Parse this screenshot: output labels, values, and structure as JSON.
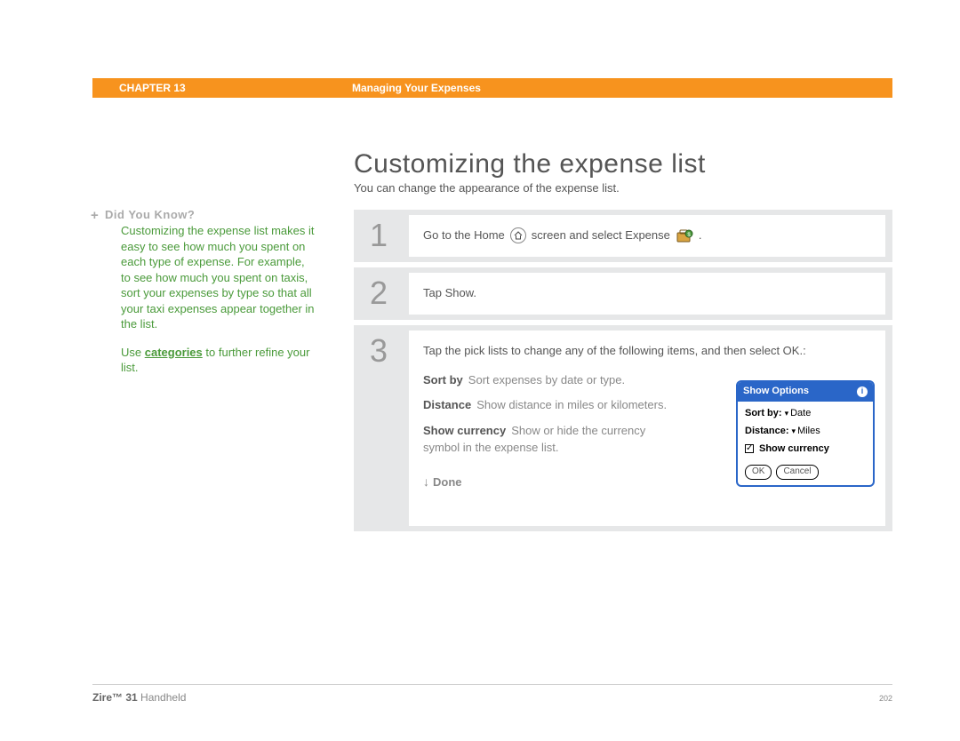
{
  "header": {
    "chapter": "CHAPTER 13",
    "section": "Managing Your Expenses"
  },
  "page": {
    "title": "Customizing the expense list",
    "intro": "You can change the appearance of the expense list."
  },
  "sidebar": {
    "dyk_label": "Did You Know?",
    "dyk_body": "Customizing the expense list makes it easy to see how much you spent on each type of expense. For example, to see how much you spent on taxis, sort your expenses by type so that all your taxi expenses appear together in the list.",
    "tip_prefix": "Use ",
    "tip_link": "categories",
    "tip_suffix": " to further refine your list."
  },
  "steps": {
    "s1": {
      "num": "1",
      "pre": "Go to the Home ",
      "mid": " screen and select Expense ",
      "post": " ."
    },
    "s2": {
      "num": "2",
      "text": "Tap Show."
    },
    "s3": {
      "num": "3",
      "lead": "Tap the pick lists to change any of the following items, and then select OK.:",
      "sortby_l": "Sort by",
      "sortby_d": "Sort expenses by date or type.",
      "distance_l": "Distance",
      "distance_d": "Show distance in miles or kilometers.",
      "showcur_l": "Show currency",
      "showcur_d": "Show or hide the currency symbol in the expense list.",
      "done": "Done"
    }
  },
  "dialog": {
    "title": "Show Options",
    "sortby_l": "Sort by:",
    "sortby_v": "Date",
    "distance_l": "Distance:",
    "distance_v": "Miles",
    "showcur": "Show currency",
    "ok": "OK",
    "cancel": "Cancel"
  },
  "footer": {
    "product_bold": "Zire™ 31",
    "product_rest": " Handheld",
    "page": "202"
  }
}
